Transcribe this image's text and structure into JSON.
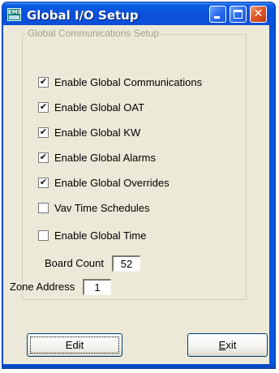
{
  "window": {
    "title": "Global I/O Setup",
    "icon": "app-icon",
    "icon_text": "EMS",
    "controls": [
      "minimize-icon",
      "maximize-icon",
      "close-icon"
    ]
  },
  "group": {
    "label": "Global Communications Setup"
  },
  "checkboxes": [
    {
      "label": "Enable Global Communications",
      "checked": true
    },
    {
      "label": "Enable Global OAT",
      "checked": true
    },
    {
      "label": "Enable Global KW",
      "checked": true
    },
    {
      "label": "Enable Global Alarms",
      "checked": true
    },
    {
      "label": "Enable Global Overrides",
      "checked": true
    },
    {
      "label": "Vav Time Schedules",
      "checked": false
    },
    {
      "label": "Enable Global Time",
      "checked": false
    }
  ],
  "fields": {
    "board_count": {
      "label": "Board Count",
      "value": "52"
    },
    "zone_address": {
      "label": "Zone Address",
      "value": "1"
    }
  },
  "buttons": {
    "edit": "Edit",
    "exit_accel": "E",
    "exit_rest": "xit"
  },
  "colors": {
    "title_bar": "#0b55de",
    "dialog_bg": "#ece9d8",
    "close_button": "#e05a2a"
  }
}
